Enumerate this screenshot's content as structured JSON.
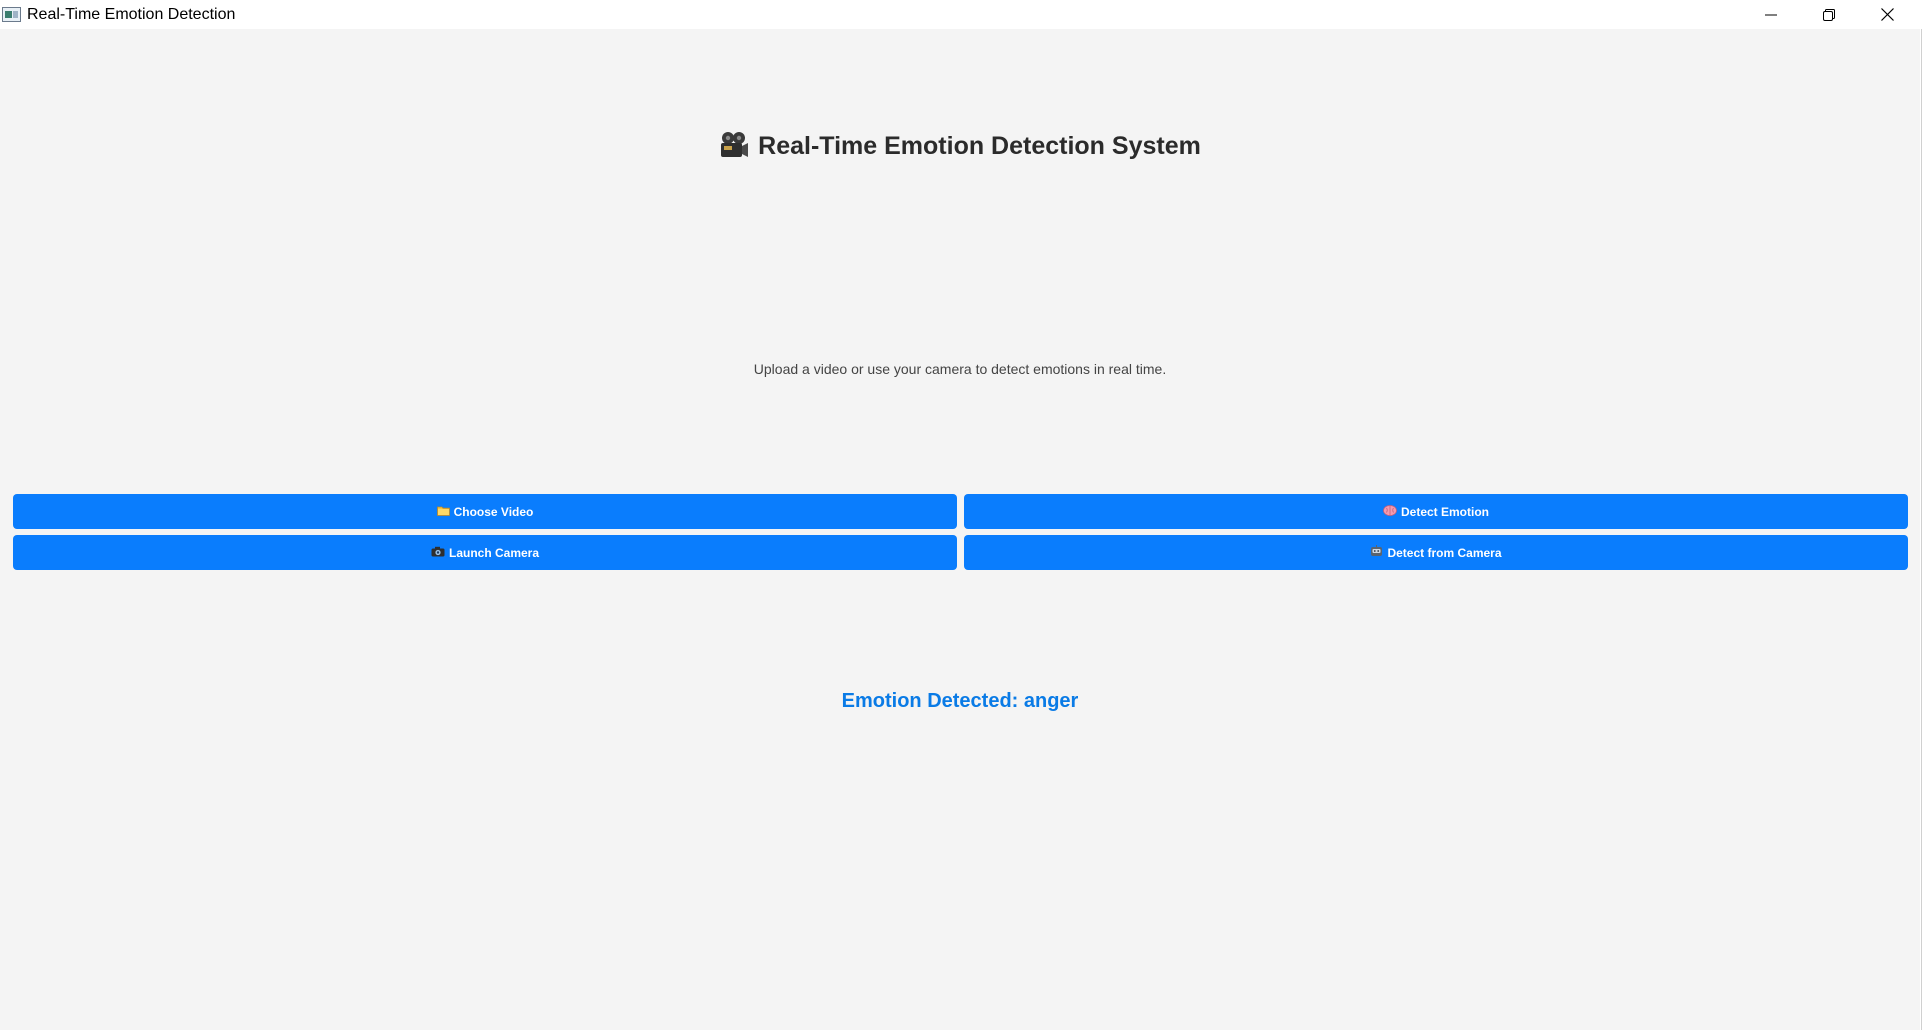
{
  "window": {
    "title": "Real-Time Emotion Detection",
    "controls": {
      "minimize": "minimize-icon",
      "maximize": "restore-icon",
      "close": "close-icon"
    }
  },
  "main": {
    "heading": "Real-Time Emotion Detection System",
    "heading_icon": "film-camera-icon",
    "subtitle": "Upload a video or use your camera to detect emotions in real time."
  },
  "buttons": {
    "choose_video": {
      "label": "Choose Video",
      "icon": "folder-icon"
    },
    "detect_emotion": {
      "label": "Detect Emotion",
      "icon": "brain-icon"
    },
    "launch_camera": {
      "label": "Launch Camera",
      "icon": "camera-icon"
    },
    "detect_from_camera": {
      "label": "Detect from Camera",
      "icon": "robot-icon"
    }
  },
  "result": {
    "text": "Emotion Detected: anger"
  },
  "colors": {
    "background": "#f4f4f4",
    "button": "#0a7dfd",
    "result_text": "#0a7be6",
    "heading_text": "#2b2b2b"
  }
}
